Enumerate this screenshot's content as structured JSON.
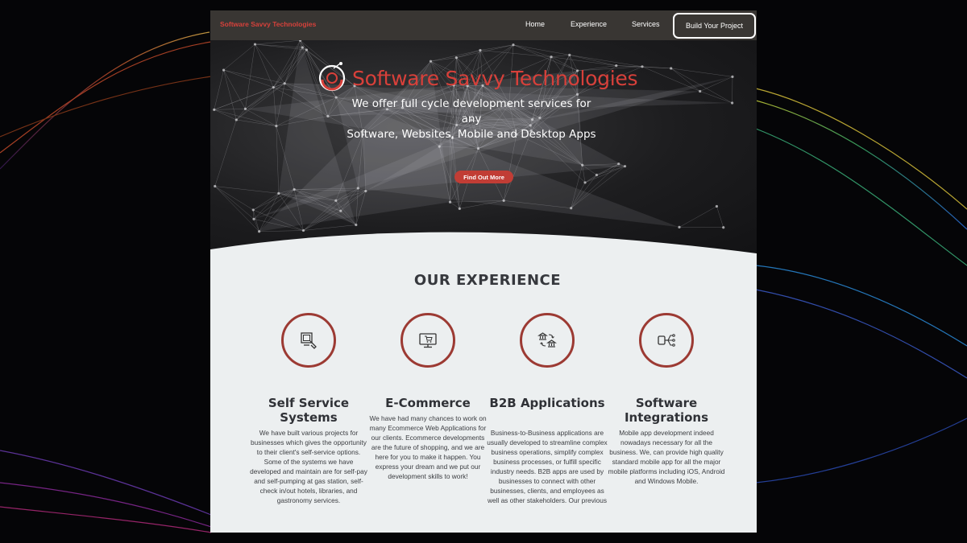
{
  "nav": {
    "brand": "Software Savvy Technologies",
    "links": [
      "Home",
      "Experience",
      "Services"
    ],
    "cta": "Build Your Project"
  },
  "hero": {
    "title": "Software Savvy Technologies",
    "subtitle_line1": "We offer full cycle development services for any",
    "subtitle_line2": "Software, Websites, Mobile and Desktop Apps",
    "button": "Find Out More"
  },
  "experience": {
    "title": "OUR EXPERIENCE",
    "cards": [
      {
        "icon": "self-service-kiosk-icon",
        "title": "Self Service Systems",
        "text": "We have built various projects for businesses which gives the opportunity to their client's self-service options. Some of the systems we have developed and maintain are for self-pay and self-pumping at gas station, self-check in/out hotels, libraries, and gastronomy services."
      },
      {
        "icon": "ecommerce-monitor-icon",
        "title": "E-Commerce",
        "text": "We have had many chances to work on many Ecommerce Web Applications for our clients. Ecommerce developments are the future of shopping, and we are here for you to make it happen. You express your dream and we put our development skills to work!"
      },
      {
        "icon": "b2b-exchange-icon",
        "title": "B2B Applications",
        "text": "Business-to-Business applications are usually developed to streamline complex business operations, simplify complex business processes, or fulfill specific industry needs. B2B apps are used by businesses to connect with other businesses, clients, and employees as well as other stakeholders. Our previous"
      },
      {
        "icon": "integration-nodes-icon",
        "title": "Software Integrations",
        "text": "Mobile app development indeed nowadays necessary for all the business. We, can provide high quality standard mobile app for all the major mobile platforms including iOS, Android and Windows Mobile."
      }
    ]
  },
  "colors": {
    "accent_red": "#d6413b",
    "button_red": "#c13d35",
    "circle_border": "#9c3a33",
    "nav_bg": "#393633",
    "section_bg": "#eceff0"
  }
}
